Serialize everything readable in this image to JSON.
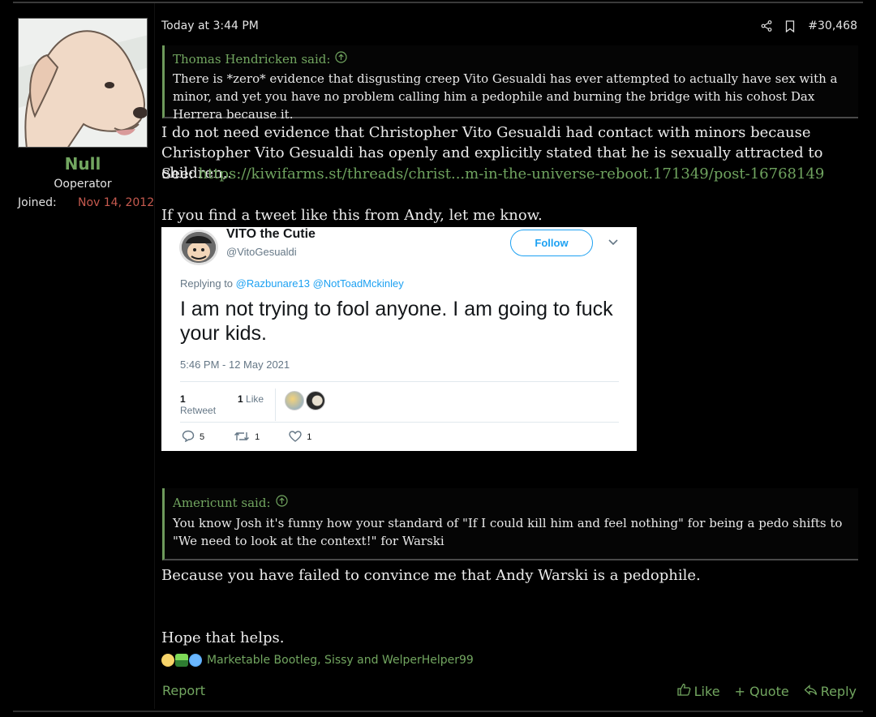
{
  "post": {
    "time": "Today at 3:44 PM",
    "number": "#30,468"
  },
  "author": {
    "name": "Null",
    "title": "Ooperator",
    "joined_label": "Joined:",
    "joined_date": "Nov 14, 2012"
  },
  "quote1": {
    "author": "Thomas Hendricken said:",
    "text": "There is *zero* evidence that disgusting creep Vito Gesualdi has ever attempted to actually have sex with a minor, and yet you have no problem calling him a pedophile and burning the bridge with his cohost Dax Herrera because it."
  },
  "body": {
    "para1": "I do not need evidence that Christopher Vito Gesualdi had contact with minors because Christopher Vito Gesualdi has openly and explicitly stated that he is sexually attracted to children,.",
    "see_label": "See:",
    "link": "https://kiwifarms.st/threads/christ...m-in-the-universe-reboot.171349/post-16768149",
    "para2": "If you find a tweet like this from Andy, let me know.",
    "para3": "Because you have failed to convince me that Andy Warski is a pedophile.",
    "para4": "Hope that helps."
  },
  "tweet": {
    "display_name": "VITO the Cutie",
    "handle": "@VitoGesualdi",
    "follow": "Follow",
    "replying_to": "Replying to",
    "mention1": "@Razbunare13",
    "mention2": "@NotToadMckinley",
    "text": "I am not trying to fool anyone. I am going to fuck your kids.",
    "date": "5:46 PM - 12 May 2021",
    "retweet_count": "1",
    "retweet_label": "Retweet",
    "like_count": "1",
    "like_label": "Like",
    "reply_action_count": "5",
    "retweet_action_count": "1",
    "like_action_count": "1"
  },
  "quote2": {
    "author": "Americunt said:",
    "text": "You know Josh it's funny how your standard of \"If I could kill him and feel nothing\" for being a pedo shifts to \"We need to look at the context!\" for Warski"
  },
  "reactions": {
    "text": "Marketable Bootleg, Sissy and WelperHelper99"
  },
  "footer": {
    "report": "Report",
    "like": "Like",
    "quote": "+ Quote",
    "reply": "Reply"
  }
}
